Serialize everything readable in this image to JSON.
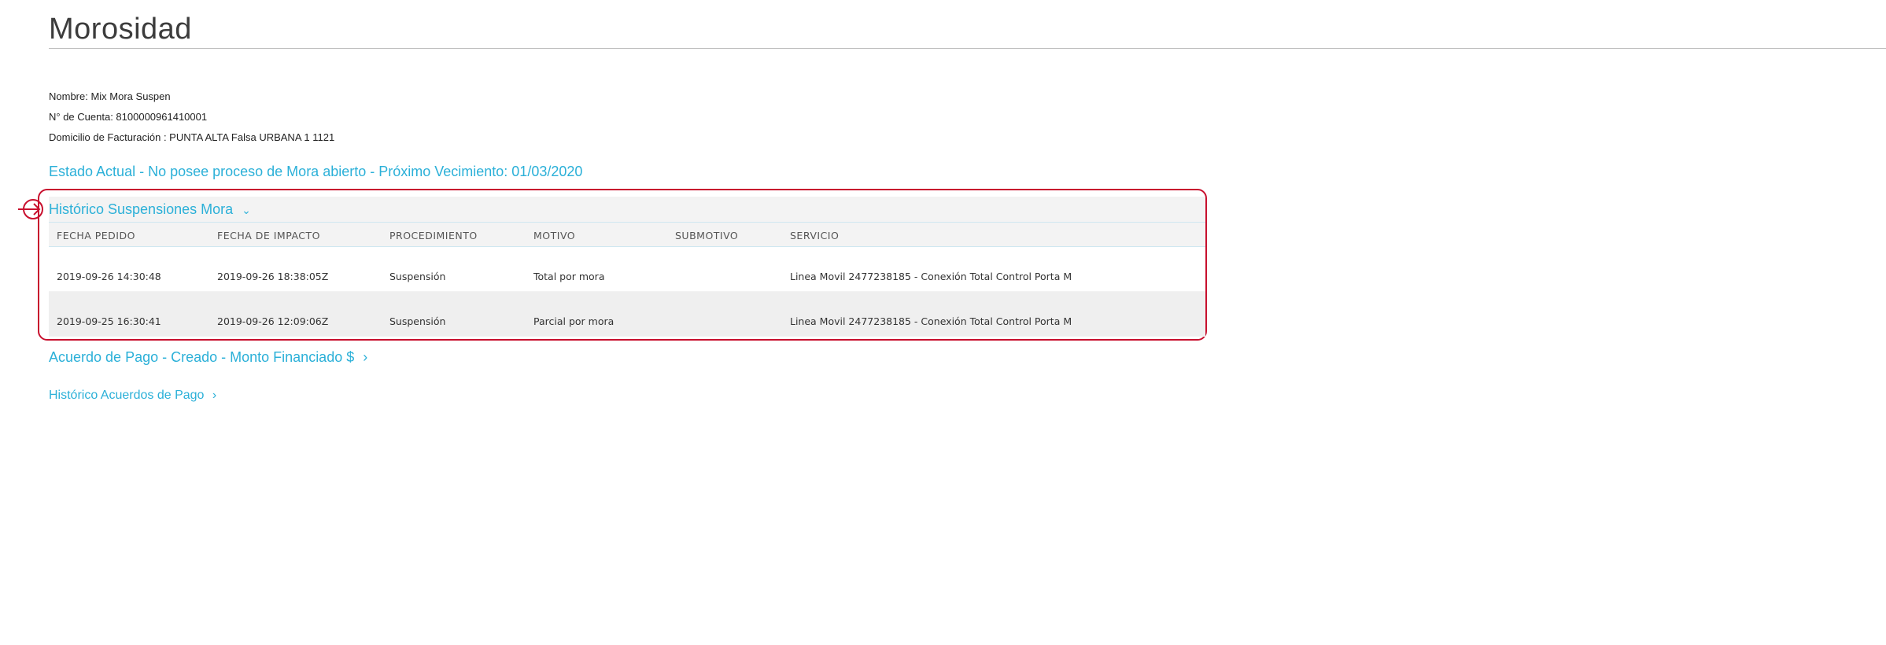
{
  "page": {
    "title": "Morosidad"
  },
  "account": {
    "nombre": "Nombre: Mix Mora Suspen",
    "cuenta": "N° de Cuenta: 8100000961410001",
    "domicilio": "Domicilio de Facturación : PUNTA ALTA Falsa URBANA 1 1121"
  },
  "estado_actual": "Estado Actual - No posee proceso de Mora abierto - Próximo Vecimiento: 01/03/2020",
  "historico_suspensiones": {
    "title": "Histórico Suspensiones Mora",
    "chevron": "⌄",
    "columns": [
      "FECHA PEDIDO",
      "FECHA DE IMPACTO",
      "PROCEDIMIENTO",
      "MOTIVO",
      "SUBMOTIVO",
      "SERVICIO"
    ],
    "rows": [
      {
        "fecha_pedido": "2019-09-26 14:30:48",
        "fecha_impacto": "2019-09-26 18:38:05Z",
        "procedimiento": "Suspensión",
        "motivo": "Total por mora",
        "submotivo": "",
        "servicio": "Linea Movil 2477238185 - Conexión Total Control Porta M"
      },
      {
        "fecha_pedido": "2019-09-25 16:30:41",
        "fecha_impacto": "2019-09-26 12:09:06Z",
        "procedimiento": "Suspensión",
        "motivo": "Parcial por mora",
        "submotivo": "",
        "servicio": "Linea Movil 2477238185 - Conexión Total Control Porta M"
      }
    ]
  },
  "acuerdo_pago": {
    "label": "Acuerdo de Pago - Creado - Monto Financiado $",
    "chevron": "›"
  },
  "historico_acuerdos": {
    "label": "Histórico Acuerdos de Pago",
    "chevron": "›"
  },
  "colors": {
    "link": "#2bb0d8",
    "highlight": "#c8102e",
    "panel_bg": "#f3f3f3"
  },
  "icons": {
    "marker": "circle-arrow-right-icon"
  }
}
